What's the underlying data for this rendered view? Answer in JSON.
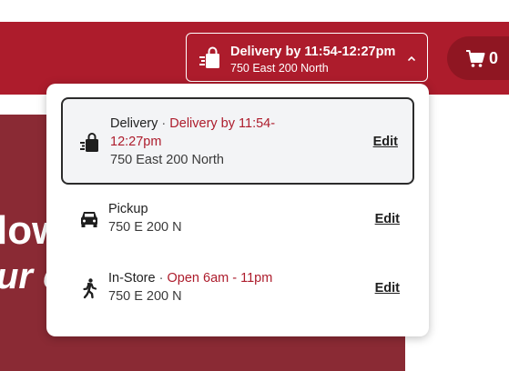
{
  "header": {
    "delivery_button": {
      "title": "Delivery by 11:54-12:27pm",
      "address": "750 East 200 North"
    },
    "cart": {
      "count": "0"
    },
    "brand_color": "#ad1c2c"
  },
  "hero": {
    "line1": "low",
    "line2": "ur c"
  },
  "fulfillment_menu": {
    "options": [
      {
        "name": "Delivery",
        "separator": "·",
        "status": "Delivery by 11:54-12:27pm",
        "address": "750 East 200 North",
        "edit_label": "Edit",
        "icon": "delivery-bag-icon",
        "selected": true
      },
      {
        "name": "Pickup",
        "separator": "",
        "status": "",
        "address": "750 E 200 N",
        "edit_label": "Edit",
        "icon": "car-icon",
        "selected": false
      },
      {
        "name": "In-Store",
        "separator": "·",
        "status": "Open 6am - 11pm",
        "address": "750 E 200 N",
        "edit_label": "Edit",
        "icon": "walking-person-icon",
        "selected": false
      }
    ]
  }
}
